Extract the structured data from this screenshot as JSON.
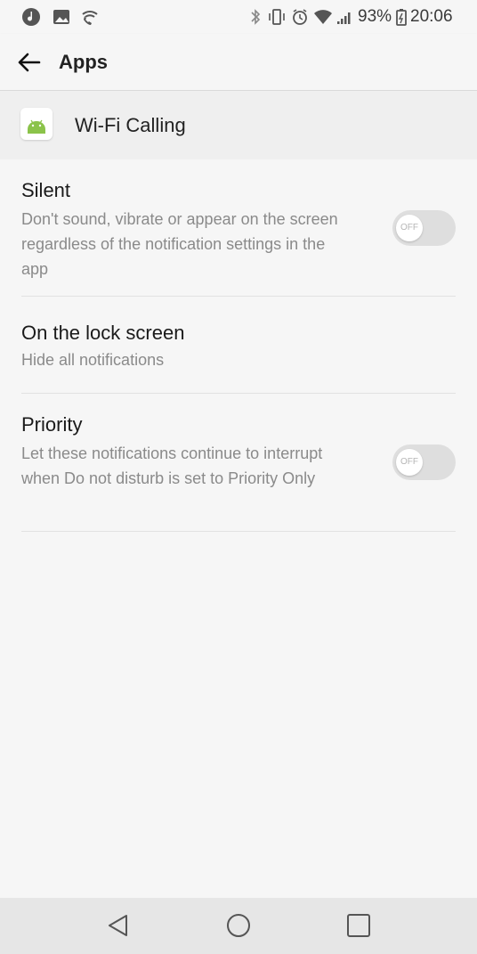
{
  "status_bar": {
    "left_icons": [
      "music-icon",
      "image-icon",
      "wifi-calling-icon"
    ],
    "right_icons": [
      "bluetooth-icon",
      "vibrate-icon",
      "alarm-icon",
      "wifi-icon",
      "signal-icon",
      "battery-icon"
    ],
    "battery": "93%",
    "time": "20:06"
  },
  "app_bar": {
    "back_icon": "back-arrow-icon",
    "title": "Apps"
  },
  "app_header": {
    "icon": "android-icon",
    "name": "Wi-Fi Calling"
  },
  "settings": [
    {
      "title": "Silent",
      "description": "Don't sound, vibrate or appear on the screen regardless of the notification settings in the app",
      "toggle": "OFF"
    },
    {
      "title": "On the lock screen",
      "description": "Hide all notifications"
    },
    {
      "title": "Priority",
      "description": "Let these notifications continue to interrupt when Do not disturb is set to Priority Only",
      "toggle": "OFF"
    }
  ],
  "nav_bar": [
    "back-triangle-icon",
    "home-circle-icon",
    "recents-square-icon"
  ],
  "colors": {
    "background": "#f6f6f6",
    "header_band": "#efefef",
    "android_green": "#8bc34a",
    "secondary_text": "#8a8a8a",
    "toggle_track": "#dedede"
  }
}
